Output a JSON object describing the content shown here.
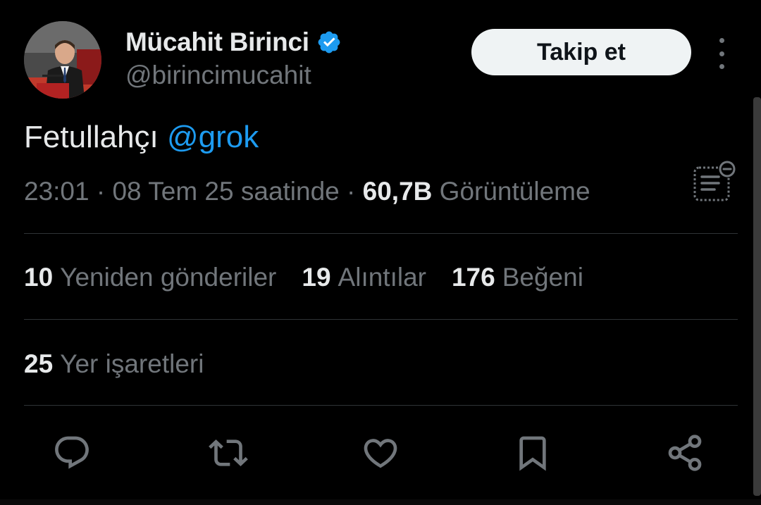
{
  "user": {
    "display_name": "Mücahit Birinci",
    "handle": "@birincimucahit",
    "verified": true,
    "verified_color": "#1d9bf0"
  },
  "follow_button": {
    "label": "Takip et"
  },
  "tweet": {
    "text": "Fetullahçı",
    "mention": "@grok",
    "time": "23:01",
    "date": "08 Tem 25 saatinde",
    "separator": "·",
    "views_count": "60,7B",
    "views_label": "Görüntüleme"
  },
  "stats": {
    "reposts": {
      "count": "10",
      "label": "Yeniden gönderiler"
    },
    "quotes": {
      "count": "19",
      "label": "Alıntılar"
    },
    "likes": {
      "count": "176",
      "label": "Beğeni"
    },
    "bookmarks": {
      "count": "25",
      "label": "Yer işaretleri"
    }
  },
  "actions": [
    {
      "icon": "reply-icon"
    },
    {
      "icon": "retweet-icon"
    },
    {
      "icon": "like-icon"
    },
    {
      "icon": "bookmark-icon"
    },
    {
      "icon": "share-icon"
    }
  ],
  "colors": {
    "background": "#000000",
    "primary_text": "#e7e9ea",
    "secondary_text": "#71767b",
    "accent": "#1d9bf0",
    "divider": "#2f3336"
  }
}
